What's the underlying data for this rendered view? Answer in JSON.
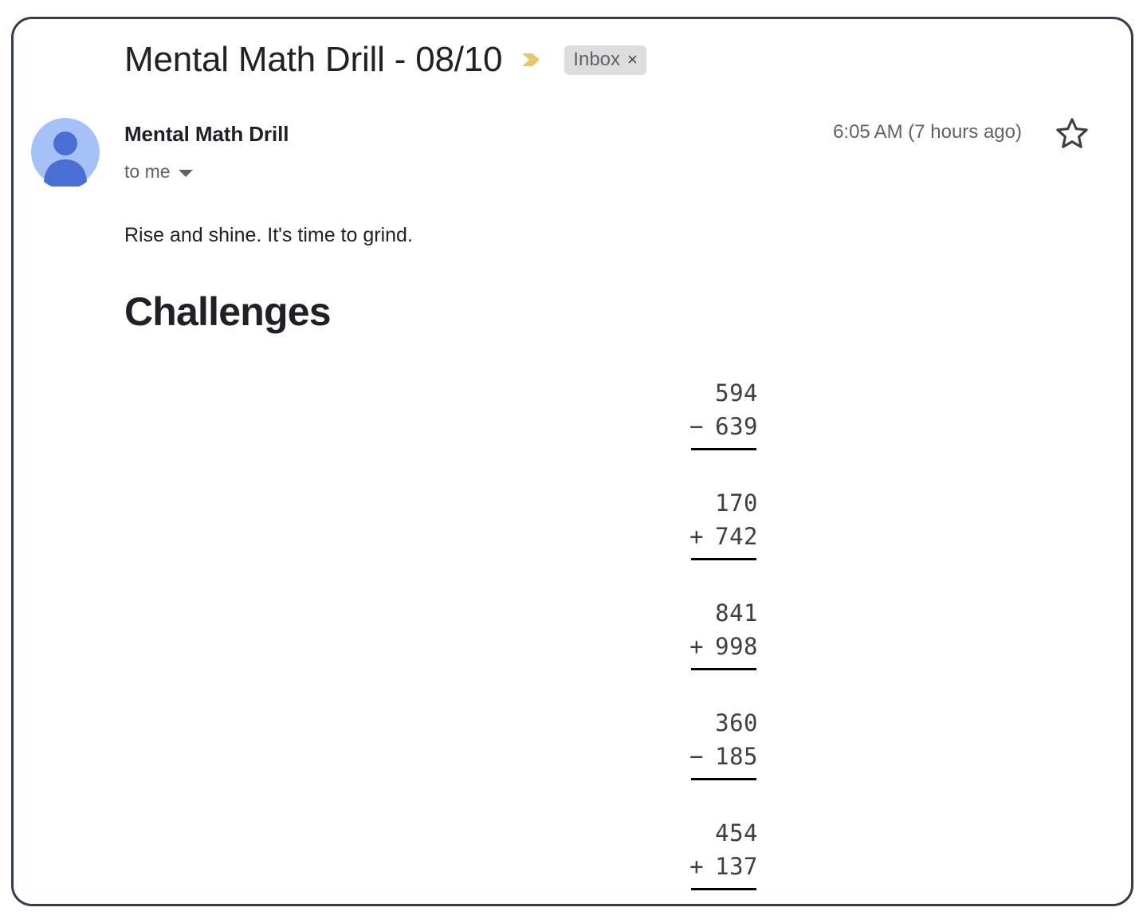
{
  "email": {
    "subject": "Mental Math Drill - 08/10",
    "important_marker_icon": "important-chevron-icon",
    "label_chip": {
      "text": "Inbox",
      "close_glyph": "×"
    },
    "sender": {
      "name": "Mental Math Drill",
      "avatar_icon": "person-avatar-icon",
      "recipient": "to me",
      "recipient_caret_icon": "chevron-down-icon"
    },
    "timestamp": "6:05 AM (7 hours ago)",
    "star_icon": "star-outline-icon",
    "body": {
      "greeting": "Rise and shine. It's time to grind.",
      "heading": "Challenges"
    }
  },
  "problems": [
    {
      "top": "594",
      "operator": "−",
      "bottom": "639"
    },
    {
      "top": "170",
      "operator": "+",
      "bottom": "742"
    },
    {
      "top": "841",
      "operator": "+",
      "bottom": "998"
    },
    {
      "top": "360",
      "operator": "−",
      "bottom": "185"
    },
    {
      "top": "454",
      "operator": "+",
      "bottom": "137"
    }
  ],
  "colors": {
    "frame_border": "#343c49",
    "text_primary": "#202124",
    "text_secondary": "#5f6368",
    "chip_background": "#ddddde",
    "important_chevron": "#e8c46c",
    "avatar_background": "#a6c1f7",
    "avatar_person": "#4a6fd4",
    "rule": "#000000"
  }
}
